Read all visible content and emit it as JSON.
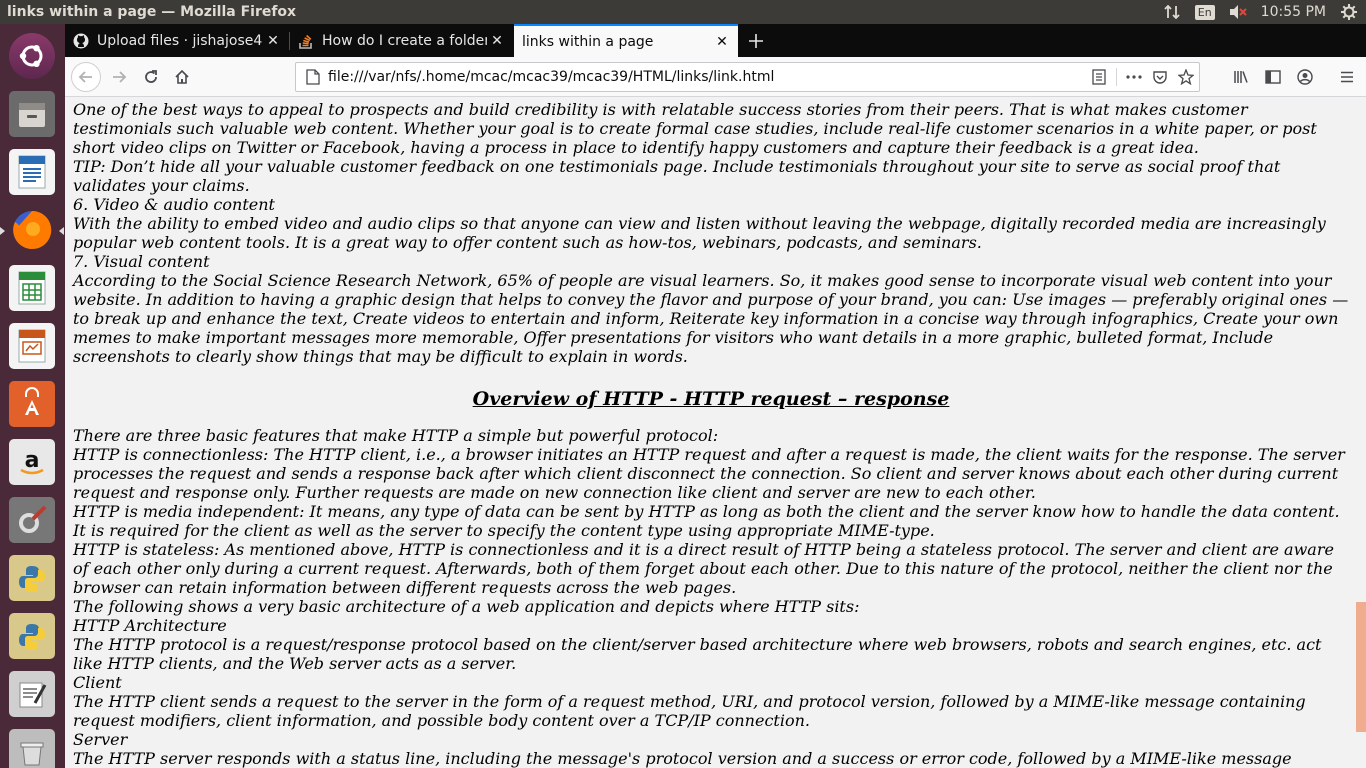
{
  "window": {
    "title": "links within a page — Mozilla Firefox"
  },
  "panel": {
    "keyboard": "En",
    "clock": "10:55 PM"
  },
  "launcher": {
    "items": [
      {
        "name": "ubuntu-dash-icon"
      },
      {
        "name": "files-icon"
      },
      {
        "name": "writer-icon"
      },
      {
        "name": "firefox-icon"
      },
      {
        "name": "calc-icon"
      },
      {
        "name": "impress-icon"
      },
      {
        "name": "software-center-icon"
      },
      {
        "name": "amazon-icon"
      },
      {
        "name": "system-settings-icon"
      },
      {
        "name": "python-icon"
      },
      {
        "name": "python-icon-2"
      },
      {
        "name": "text-editor-icon"
      },
      {
        "name": "trash-icon"
      }
    ]
  },
  "tabs": [
    {
      "label": "Upload files · jishajose49",
      "favicon": "github-icon"
    },
    {
      "label": "How do I create a folder",
      "favicon": "stackoverflow-icon"
    },
    {
      "label": "links within a page",
      "favicon": ""
    }
  ],
  "urlbar": {
    "url": "file:///var/nfs/.home/mcac/mcac39/mcac39/HTML/links/link.html"
  },
  "content": {
    "top_paragraphs": [
      "One of the best ways to appeal to prospects and build credibility is with relatable success stories from their peers. That is what makes customer testimonials such valuable web content. Whether your goal is to create formal case studies, include real-life customer scenarios in a white paper, or post short video clips on Twitter or Facebook, having a process in place to identify happy customers and capture their feedback is a great idea.",
      "TIP: Don’t hide all your valuable customer feedback on one testimonials page. Include testimonials throughout your site to serve as social proof that validates your claims.",
      "6. Video & audio content",
      "With the ability to embed video and audio clips so that anyone can view and listen without leaving the webpage, digitally recorded media are increasingly popular web content tools. It is a great way to offer content such as how-tos, webinars, podcasts, and seminars.",
      "7. Visual content",
      "According to the Social Science Research Network, 65% of people are visual learners. So, it makes good sense to incorporate visual web content into your website. In addition to having a graphic design that helps to convey the flavor and purpose of your brand, you can: Use images — preferably original ones — to break up and enhance the text, Create videos to entertain and inform, Reiterate key information in a concise way through infographics, Create your own memes to make important messages more memorable, Offer presentations for visitors who want details in a more graphic, bulleted format, Include screenshots to clearly show things that may be difficult to explain in words."
    ],
    "heading": "Overview of HTTP - HTTP request – response",
    "bottom_paragraphs": [
      "There are three basic features that make HTTP a simple but powerful protocol:",
      "HTTP is connectionless: The HTTP client, i.e., a browser initiates an HTTP request and after a request is made, the client waits for the response. The server processes the request and sends a response back after which client disconnect the connection. So client and server knows about each other during current request and response only. Further requests are made on new connection like client and server are new to each other.",
      "HTTP is media independent: It means, any type of data can be sent by HTTP as long as both the client and the server know how to handle the data content. It is required for the client as well as the server to specify the content type using appropriate MIME-type.",
      "HTTP is stateless: As mentioned above, HTTP is connectionless and it is a direct result of HTTP being a stateless protocol. The server and client are aware of each other only during a current request. Afterwards, both of them forget about each other. Due to this nature of the protocol, neither the client nor the browser can retain information between different requests across the web pages.",
      "The following shows a very basic architecture of a web application and depicts where HTTP sits:",
      "HTTP Architecture",
      "The HTTP protocol is a request/response protocol based on the client/server based architecture where web browsers, robots and search engines, etc. act like HTTP clients, and the Web server acts as a server.",
      "Client",
      "The HTTP client sends a request to the server in the form of a request method, URI, and protocol version, followed by a MIME-like message containing request modifiers, client information, and possible body content over a TCP/IP connection.",
      "Server",
      "The HTTP server responds with a status line, including the message's protocol version and a success or error code, followed by a MIME-like message"
    ]
  },
  "colors": {
    "panel": "#3c3b37",
    "launcher": "#4a2a38",
    "tabbar": "#0c0c0d",
    "accent": "#0a84ff",
    "page_bg": "#f2f2f2",
    "scrollbar": "#f0a07c"
  }
}
